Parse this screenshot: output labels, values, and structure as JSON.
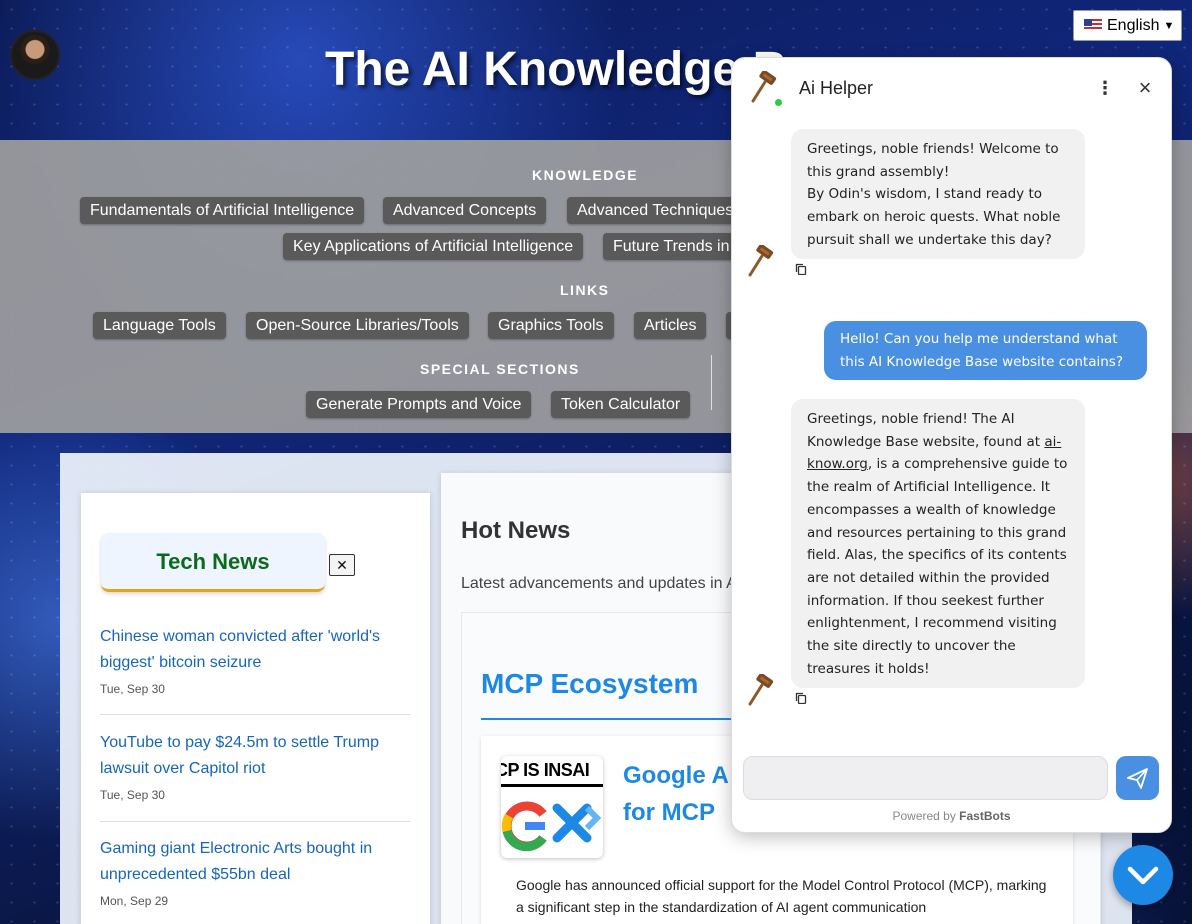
{
  "header": {
    "title": "The AI Knowledge B",
    "language": {
      "selected": "English"
    }
  },
  "nav": {
    "knowledge_heading": "KNOWLEDGE",
    "knowledge": [
      "Fundamentals of Artificial Intelligence",
      "Advanced Concepts",
      "Advanced Techniques",
      "Key Applications of Artificial Intelligence",
      "Future Trends in"
    ],
    "links_heading": "LINKS",
    "links": [
      "Language Tools",
      "Open-Source Libraries/Tools",
      "Graphics Tools",
      "Articles"
    ],
    "special_heading": "SPECIAL SECTIONS",
    "special": [
      "Generate Prompts and Voice",
      "Token Calculator"
    ]
  },
  "tech_news": {
    "title": "Tech News",
    "close": "✕",
    "items": [
      {
        "headline": "Chinese woman convicted after 'world's biggest' bitcoin seizure",
        "date": "Tue, Sep 30"
      },
      {
        "headline": "YouTube to pay $24.5m to settle Trump lawsuit over Capitol riot",
        "date": "Tue, Sep 30"
      },
      {
        "headline": "Gaming giant Electronic Arts bought in unprecedented $55bn deal",
        "date": "Mon, Sep 29"
      }
    ]
  },
  "hot_news": {
    "title": "Hot News",
    "subtitle": "Latest advancements and updates in A",
    "section_title": "MCP Ecosystem",
    "article": {
      "thumb_text": "CP IS INSAI",
      "title": "Google A for MCP",
      "body": "Google has announced official support for the Model Control Protocol (MCP), marking a significant step in the standardization of AI agent communication"
    }
  },
  "chat": {
    "title": "Ai Helper",
    "messages": [
      {
        "role": "bot",
        "text": "Greetings, noble friends! Welcome to this grand assembly!\nBy Odin's wisdom, I stand ready to embark on heroic quests. What noble pursuit shall we undertake this day?"
      },
      {
        "role": "user",
        "text": "Hello! Can you help me understand what this AI Knowledge Base website contains?"
      },
      {
        "role": "bot",
        "text_before": "Greetings, noble friend! The AI Knowledge Base website, found at ",
        "link": "ai-know.org",
        "text_after": ", is a comprehensive guide to the realm of Artificial Intelligence. It encompasses a wealth of knowledge and resources pertaining to this grand field. Alas, the specifics of its contents are not detailed within the provided information. If thou seekest further enlightenment, I recommend visiting the site directly to uncover the treasures it holds!"
      }
    ],
    "input_value": "",
    "powered_prefix": "Powered by ",
    "powered_brand": "FastBots"
  },
  "colors": {
    "accent": "#1e88e5",
    "chat_user_bubble": "#4a90e2",
    "pill_bg": "#5a5a5a",
    "news_link": "#1565c0",
    "tech_news_title": "#0b6b1a"
  },
  "icons": [
    "avatar",
    "us-flag-icon",
    "gavel-bot-icon",
    "more-vert-icon",
    "close-icon",
    "copy-icon",
    "send-icon",
    "chevron-down-icon"
  ]
}
